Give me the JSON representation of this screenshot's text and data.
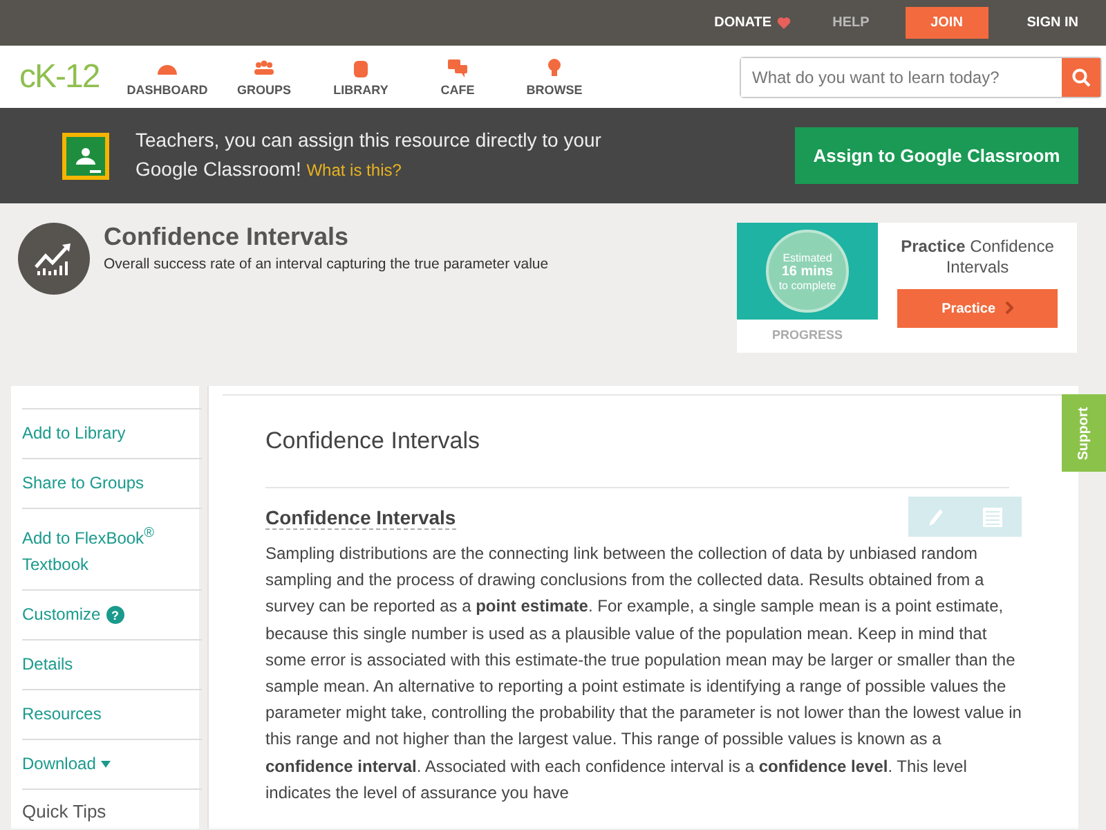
{
  "top_bar": {
    "donate": "DONATE",
    "help": "HELP",
    "join": "JOIN",
    "sign_in": "SIGN IN"
  },
  "nav": {
    "logo": "cK-12",
    "items": [
      {
        "label": "DASHBOARD"
      },
      {
        "label": "GROUPS"
      },
      {
        "label": "LIBRARY"
      },
      {
        "label": "CAFE"
      },
      {
        "label": "BROWSE"
      }
    ],
    "search": {
      "placeholder": "What do you want to learn today?"
    }
  },
  "banner": {
    "text": "Teachers, you can assign this resource directly to your Google Classroom!",
    "link": "What is this?",
    "button": "Assign to Google Classroom"
  },
  "concept": {
    "title": "Confidence Intervals",
    "subtitle": "Overall success rate of an interval capturing the true parameter value"
  },
  "practice": {
    "estimate": [
      "Estimated",
      "16 mins",
      "to complete"
    ],
    "progress": "PROGRESS",
    "heading": "**Practice** Confidence Intervals",
    "button": "Practice"
  },
  "sidebar": {
    "items": [
      {
        "label": "Add to Library",
        "kind": "link"
      },
      {
        "label": "Share to Groups",
        "kind": "link"
      },
      {
        "label": "Add to FlexBook$^{®}$ Textbook",
        "kind": "link"
      },
      {
        "label": "Customize",
        "kind": "help",
        "badge": "?"
      },
      {
        "label": "Details",
        "kind": "link"
      },
      {
        "label": "Resources",
        "kind": "link"
      },
      {
        "label": "Download",
        "kind": "dropdown"
      },
      {
        "label": "Quick Tips",
        "kind": "heading"
      }
    ]
  },
  "content": {
    "title": "Confidence Intervals",
    "section_title": "Confidence Intervals",
    "paragraph": "Sampling distributions are the connecting link between the collection of data by unbiased random sampling and the process of drawing conclusions from the collected data. Results obtained from a survey can be reported as a **point estimate**. For example, a single sample mean is a point estimate, because this single number is used as a plausible value of the population mean. Keep in mind that some error is associated with this estimate-the true population mean may be larger or smaller than the sample mean. An alternative to reporting a point estimate is identifying a range of possible values the parameter might take, controlling the probability that the parameter is not lower than the lowest value in this range and not higher than the largest value. This range of possible values is known as a **confidence interval**. Associated with each confidence interval is a **confidence level**. This level indicates the level of assurance you have"
  },
  "support": "Support"
}
